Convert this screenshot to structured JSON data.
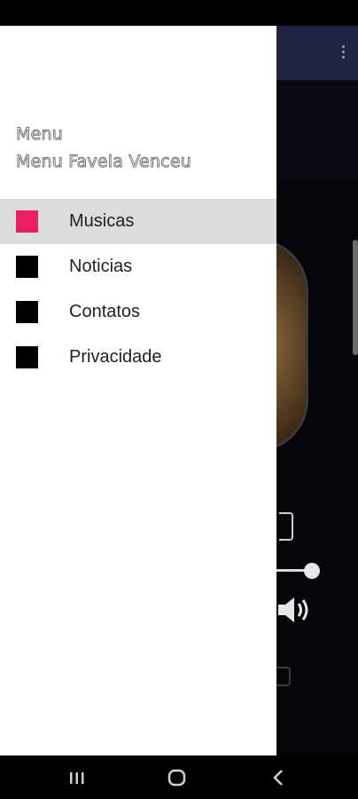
{
  "drawer": {
    "title": "Menu",
    "subtitle": "Menu Favela Venceu",
    "items": [
      {
        "label": "Musicas",
        "selected": true,
        "icon_color": "#e91e63"
      },
      {
        "label": "Noticias",
        "selected": false,
        "icon_color": "#000000"
      },
      {
        "label": "Contatos",
        "selected": false,
        "icon_color": "#000000"
      },
      {
        "label": "Privacidade",
        "selected": false,
        "icon_color": "#000000"
      }
    ]
  },
  "app": {
    "toolbar_color": "#1e2540",
    "icons": [
      "more-vert-icon",
      "album-art",
      "volume-up-icon"
    ]
  },
  "nav_bar": {
    "icons": [
      "recent-apps-icon",
      "home-icon",
      "back-icon"
    ]
  },
  "colors": {
    "accent": "#e91e63",
    "selected_row": "#dcdcdc"
  }
}
